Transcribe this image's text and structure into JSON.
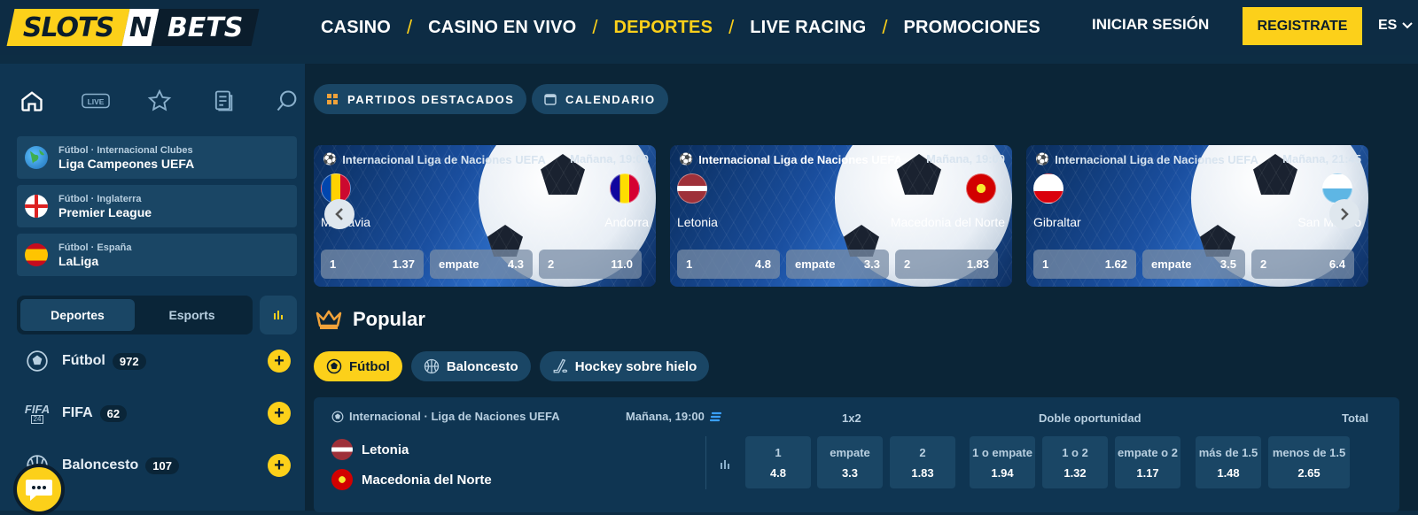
{
  "header": {
    "logo_left": "SLOTS",
    "logo_mid": "N",
    "logo_right": "BETS",
    "nav": [
      "CASINO",
      "CASINO EN VIVO",
      "DEPORTES",
      "LIVE RACING",
      "PROMOCIONES"
    ],
    "active_nav": "DEPORTES",
    "separator": "/",
    "login_label": "INICIAR SESIÓN",
    "register_label": "REGISTRATE",
    "lang": "ES"
  },
  "sidebar": {
    "icons": [
      "home-icon",
      "live-icon",
      "star-icon",
      "betslip-icon",
      "search-icon"
    ],
    "live_text": "LIVE",
    "leagues": [
      {
        "sub": "Fútbol · Internacional Clubes",
        "name": "Liga Campeones UEFA"
      },
      {
        "sub": "Fútbol · Inglaterra",
        "name": "Premier League"
      },
      {
        "sub": "Fútbol · España",
        "name": "LaLiga"
      }
    ],
    "tabs": [
      "Deportes",
      "Esports"
    ],
    "sports": [
      {
        "name": "Fútbol",
        "count": "972"
      },
      {
        "name": "FIFA",
        "count": "62"
      },
      {
        "name": "Baloncesto",
        "count": "107"
      }
    ],
    "fifa_badge": "FIFA",
    "fifa_sub": "24"
  },
  "content": {
    "pills": [
      "PARTIDOS DESTACADOS",
      "CALENDARIO"
    ],
    "cards": [
      {
        "league": "Internacional Liga de Naciones UEFA",
        "time": "Mañana, 19:00",
        "home": "Moldavia",
        "away": "Andorra",
        "odds": [
          {
            "l": "1",
            "v": "1.37"
          },
          {
            "l": "empate",
            "v": "4.3"
          },
          {
            "l": "2",
            "v": "11.0"
          }
        ]
      },
      {
        "league": "Internacional Liga de Naciones UEFA",
        "time": "Mañana, 19:00",
        "home": "Letonia",
        "away": "Macedonia del Norte",
        "odds": [
          {
            "l": "1",
            "v": "4.8"
          },
          {
            "l": "empate",
            "v": "3.3"
          },
          {
            "l": "2",
            "v": "1.83"
          }
        ]
      },
      {
        "league": "Internacional Liga de Naciones UEFA",
        "time": "Mañana, 21:45",
        "home": "Gibraltar",
        "away": "San Marino",
        "odds": [
          {
            "l": "1",
            "v": "1.62"
          },
          {
            "l": "empate",
            "v": "3.5"
          },
          {
            "l": "2",
            "v": "6.4"
          }
        ]
      }
    ],
    "popular_title": "Popular",
    "filters": [
      "Fútbol",
      "Baloncesto",
      "Hockey sobre hielo"
    ],
    "match": {
      "meta": "Internacional · Liga de Naciones UEFA",
      "time": "Mañana, 19:00",
      "headers": [
        "1x2",
        "Doble oportunidad",
        "Total"
      ],
      "home": "Letonia",
      "away": "Macedonia del Norte",
      "odds": [
        {
          "l": "1",
          "v": "4.8"
        },
        {
          "l": "empate",
          "v": "3.3"
        },
        {
          "l": "2",
          "v": "1.83"
        },
        {
          "l": "1 o empate",
          "v": "1.94"
        },
        {
          "l": "1 o 2",
          "v": "1.32"
        },
        {
          "l": "empate o 2",
          "v": "1.17"
        },
        {
          "l": "más de 1.5",
          "v": "1.48"
        },
        {
          "l": "menos de 1.5",
          "v": "2.65"
        }
      ]
    }
  },
  "colors": {
    "accent": "#fcd01a",
    "bg": "#0d2c44",
    "panel": "#1a4665"
  }
}
